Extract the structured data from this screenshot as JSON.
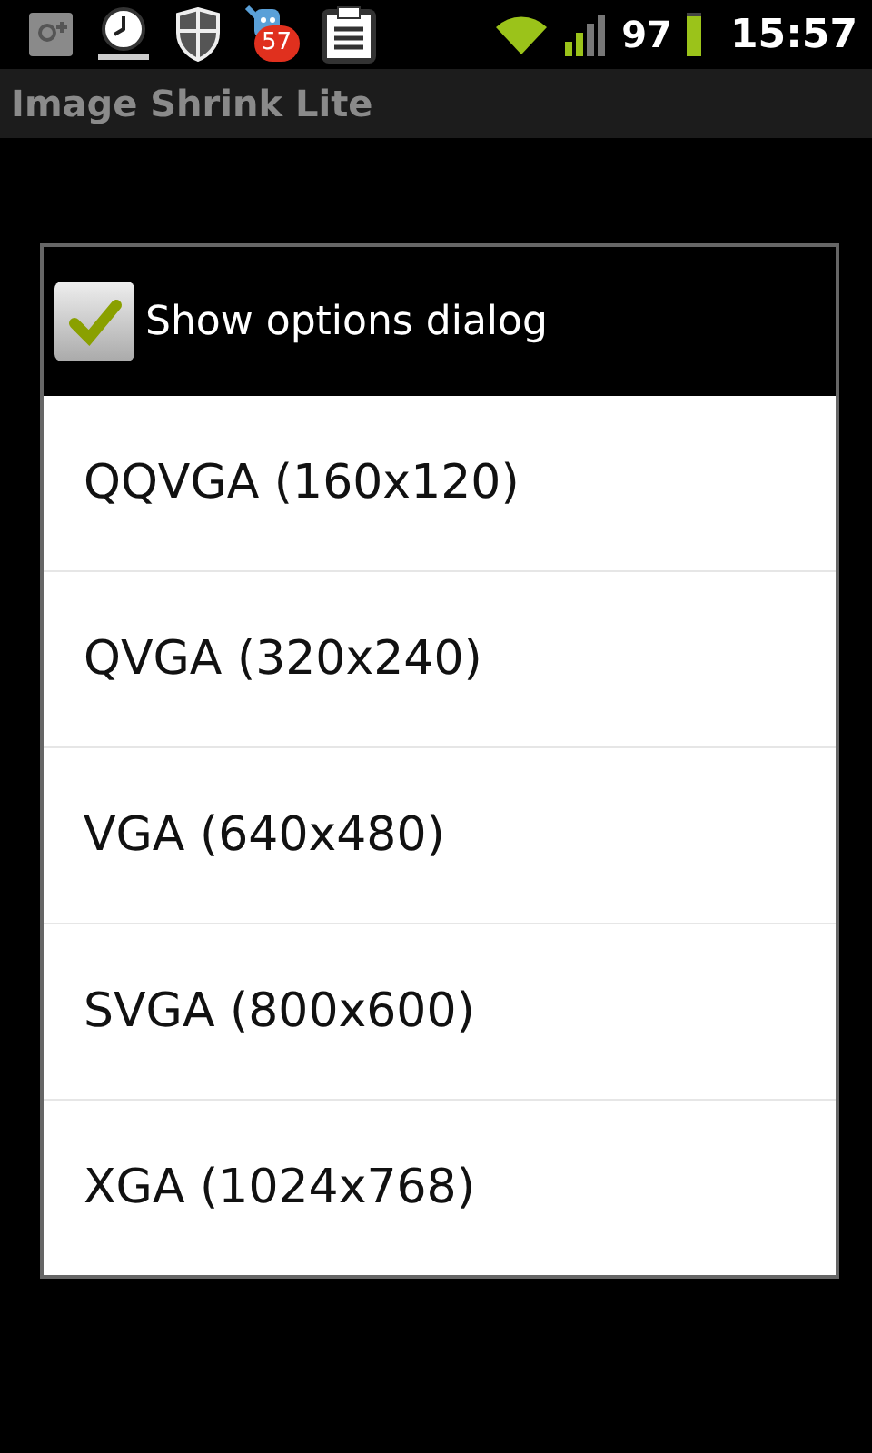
{
  "status_bar": {
    "notification_badge": "57",
    "battery": "97",
    "time": "15:57"
  },
  "title_bar": {
    "title": "Image Shrink Lite"
  },
  "dialog": {
    "option": {
      "label": "Show options dialog",
      "checked": true
    },
    "items": [
      {
        "label": "QQVGA (160x120)"
      },
      {
        "label": "QVGA (320x240)"
      },
      {
        "label": "VGA (640x480)"
      },
      {
        "label": "SVGA (800x600)"
      },
      {
        "label": "XGA (1024x768)"
      }
    ]
  }
}
